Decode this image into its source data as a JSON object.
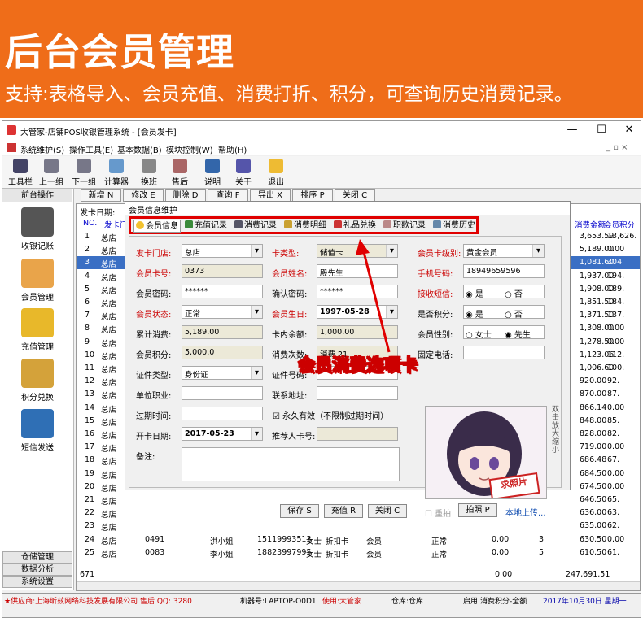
{
  "banner": {
    "title": "后台会员管理",
    "subtitle": "支持:表格导入、会员充值、消费打折、积分，可查询历史消费记录。"
  },
  "window": {
    "title": "大管家-店铺POS收银管理系统 - [会员发卡]",
    "min": "—",
    "max": "☐",
    "close": "✕",
    "sub_controls": "_ ▫ ×"
  },
  "menu": [
    "系统维护(S)",
    "操作工具(E)",
    "基本数据(B)",
    "模块控制(W)",
    "帮助(H)"
  ],
  "toolbar": [
    "工具栏",
    "上一组",
    "下一组",
    "计算器",
    "换班",
    "售后",
    "说明",
    "关于",
    "退出"
  ],
  "left": {
    "header": "前台操作",
    "nav": [
      "收银记账",
      "会员管理",
      "充值管理",
      "积分兑换",
      "短信发送"
    ],
    "bottom": [
      "仓储管理",
      "数据分析",
      "系统设置"
    ]
  },
  "actions": [
    "新增 N",
    "修改 E",
    "删除 D",
    "查询 F",
    "导出 X",
    "排序 P",
    "关闭 C"
  ],
  "grid": {
    "filter_label": "发卡日期:",
    "headers": [
      "NO.",
      "发卡门"
    ],
    "right_headers": [
      "消费金额",
      "会员积分"
    ],
    "rows": [
      {
        "no": "1",
        "store": "总店",
        "amt": "3,653.59",
        "pts": "13,626."
      },
      {
        "no": "2",
        "store": "总店",
        "amt": "5,189.00",
        "pts": "0.00"
      },
      {
        "no": "3",
        "store": "总店",
        "amt": "1,081.60",
        "pts": "304"
      },
      {
        "no": "4",
        "store": "总店",
        "amt": "1,937.00",
        "pts": "194."
      },
      {
        "no": "5",
        "store": "总店",
        "amt": "1,908.00",
        "pts": "189."
      },
      {
        "no": "6",
        "store": "总店",
        "amt": "1,851.50",
        "pts": "184."
      },
      {
        "no": "7",
        "store": "总店",
        "amt": "1,371.50",
        "pts": "137."
      },
      {
        "no": "8",
        "store": "总店",
        "amt": "1,308.00",
        "pts": "0.00"
      },
      {
        "no": "9",
        "store": "总店",
        "amt": "1,278.50",
        "pts": "0.00"
      },
      {
        "no": "10",
        "store": "总店",
        "amt": "1,123.06",
        "pts": "112."
      },
      {
        "no": "11",
        "store": "总店",
        "amt": "1,006.60",
        "pts": "100."
      },
      {
        "no": "12",
        "store": "总店",
        "amt": "920.00",
        "pts": "92."
      },
      {
        "no": "13",
        "store": "总店",
        "amt": "870.00",
        "pts": "87."
      },
      {
        "no": "14",
        "store": "总店",
        "amt": "866.14",
        "pts": "0.00"
      },
      {
        "no": "15",
        "store": "总店",
        "amt": "848.00",
        "pts": "85."
      },
      {
        "no": "16",
        "store": "总店",
        "amt": "828.00",
        "pts": "82."
      },
      {
        "no": "17",
        "store": "总店",
        "amt": "719.00",
        "pts": "0.00"
      },
      {
        "no": "18",
        "store": "总店",
        "amt": "686.48",
        "pts": "67."
      },
      {
        "no": "19",
        "store": "总店",
        "amt": "684.50",
        "pts": "0.00"
      },
      {
        "no": "20",
        "store": "总店",
        "amt": "674.50",
        "pts": "0.00"
      },
      {
        "no": "21",
        "store": "总店",
        "amt": "646.50",
        "pts": "65."
      },
      {
        "no": "22",
        "store": "总店",
        "amt": "636.00",
        "pts": "63."
      },
      {
        "no": "23",
        "store": "总店",
        "amt": "635.00",
        "pts": "62."
      },
      {
        "no": "24",
        "store": "总店",
        "card": "0491",
        "name": "洪小姐",
        "phone": "15119993513",
        "sex": "女士",
        "type": "折扣卡",
        "lvl": "会员",
        "status": "正常",
        "bal": "0.00",
        "cnt": "3",
        "amt": "630.50",
        "pts": "0.00"
      },
      {
        "no": "25",
        "store": "总店",
        "card": "0083",
        "name": "李小姐",
        "phone": "18823997995",
        "sex": "女士",
        "type": "折扣卡",
        "lvl": "会员",
        "status": "正常",
        "bal": "0.00",
        "cnt": "5",
        "amt": "610.50",
        "pts": "61."
      }
    ],
    "total_count": "671",
    "total_bal": "0.00",
    "total_amt": "247,691.51"
  },
  "dialog": {
    "title": "会员信息维护",
    "tabs": [
      "会员信息",
      "充值记录",
      "消费记录",
      "消费明细",
      "礼品兑换",
      "职歌记录",
      "消费历史"
    ],
    "labels": {
      "store": "发卡门店:",
      "card_type": "卡类型:",
      "card_level": "会员卡级别:",
      "card_no": "会员卡号:",
      "name": "会员姓名:",
      "phone": "手机号码:",
      "password": "会员密码:",
      "confirm": "确认密码:",
      "sms": "接收短信:",
      "status": "会员状态:",
      "birthday": "会员生日:",
      "points_q": "是否积分:",
      "total": "累计消费:",
      "balance": "卡内余额:",
      "gender": "会员性别:",
      "points": "会员积分:",
      "times": "消费次数:",
      "fixed_phone": "固定电话:",
      "id_type": "证件类型:",
      "id_no": "证件号码:",
      "company": "单位职业:",
      "address": "联系地址:",
      "expire": "过期时间:",
      "open_date": "开卡日期:",
      "referrer": "推荐人卡号:",
      "remark": "备注:"
    },
    "values": {
      "store": "总店",
      "card_type": "储值卡",
      "card_level": "黄金会员",
      "card_no": "0373",
      "name": "殿先生",
      "phone": "18949659596",
      "password": "******",
      "confirm": "******",
      "sms_yes": "是",
      "sms_no": "否",
      "status": "正常",
      "birthday": "1997-05-28",
      "points_yes": "是",
      "points_no": "否",
      "total": "5,189.00",
      "balance": "1,000.00",
      "female": "女士",
      "male": "先生",
      "points": "5,000.0",
      "times": "消费 21",
      "id_type": "身份证",
      "forever": "永久有效（不限制过期时间）",
      "open_date": "2017-05-23"
    },
    "photo_text": "求照片",
    "dbl_click": "双击放大缩小",
    "reshoot": "重拍",
    "photo_btn": "拍照 P",
    "upload": "本地上传...",
    "save": "保存 S",
    "recharge": "充值 R",
    "close": "关闭 C"
  },
  "callout": "会员消费选项卡",
  "status": {
    "supplier": "★供应商:上海昕兹网络科技发展有限公司 售后 QQ: 3280",
    "machine": "机器号:LAPTOP-O0D1",
    "user": "使用:大管家",
    "warehouse": "仓库:仓库",
    "points": "启用:消费积分-全额",
    "date": "2017年10月30日 星期一"
  },
  "colors": {
    "banner": "#ef6d19",
    "highlight": "#e00000",
    "selected_row": "#3a6fc4"
  }
}
